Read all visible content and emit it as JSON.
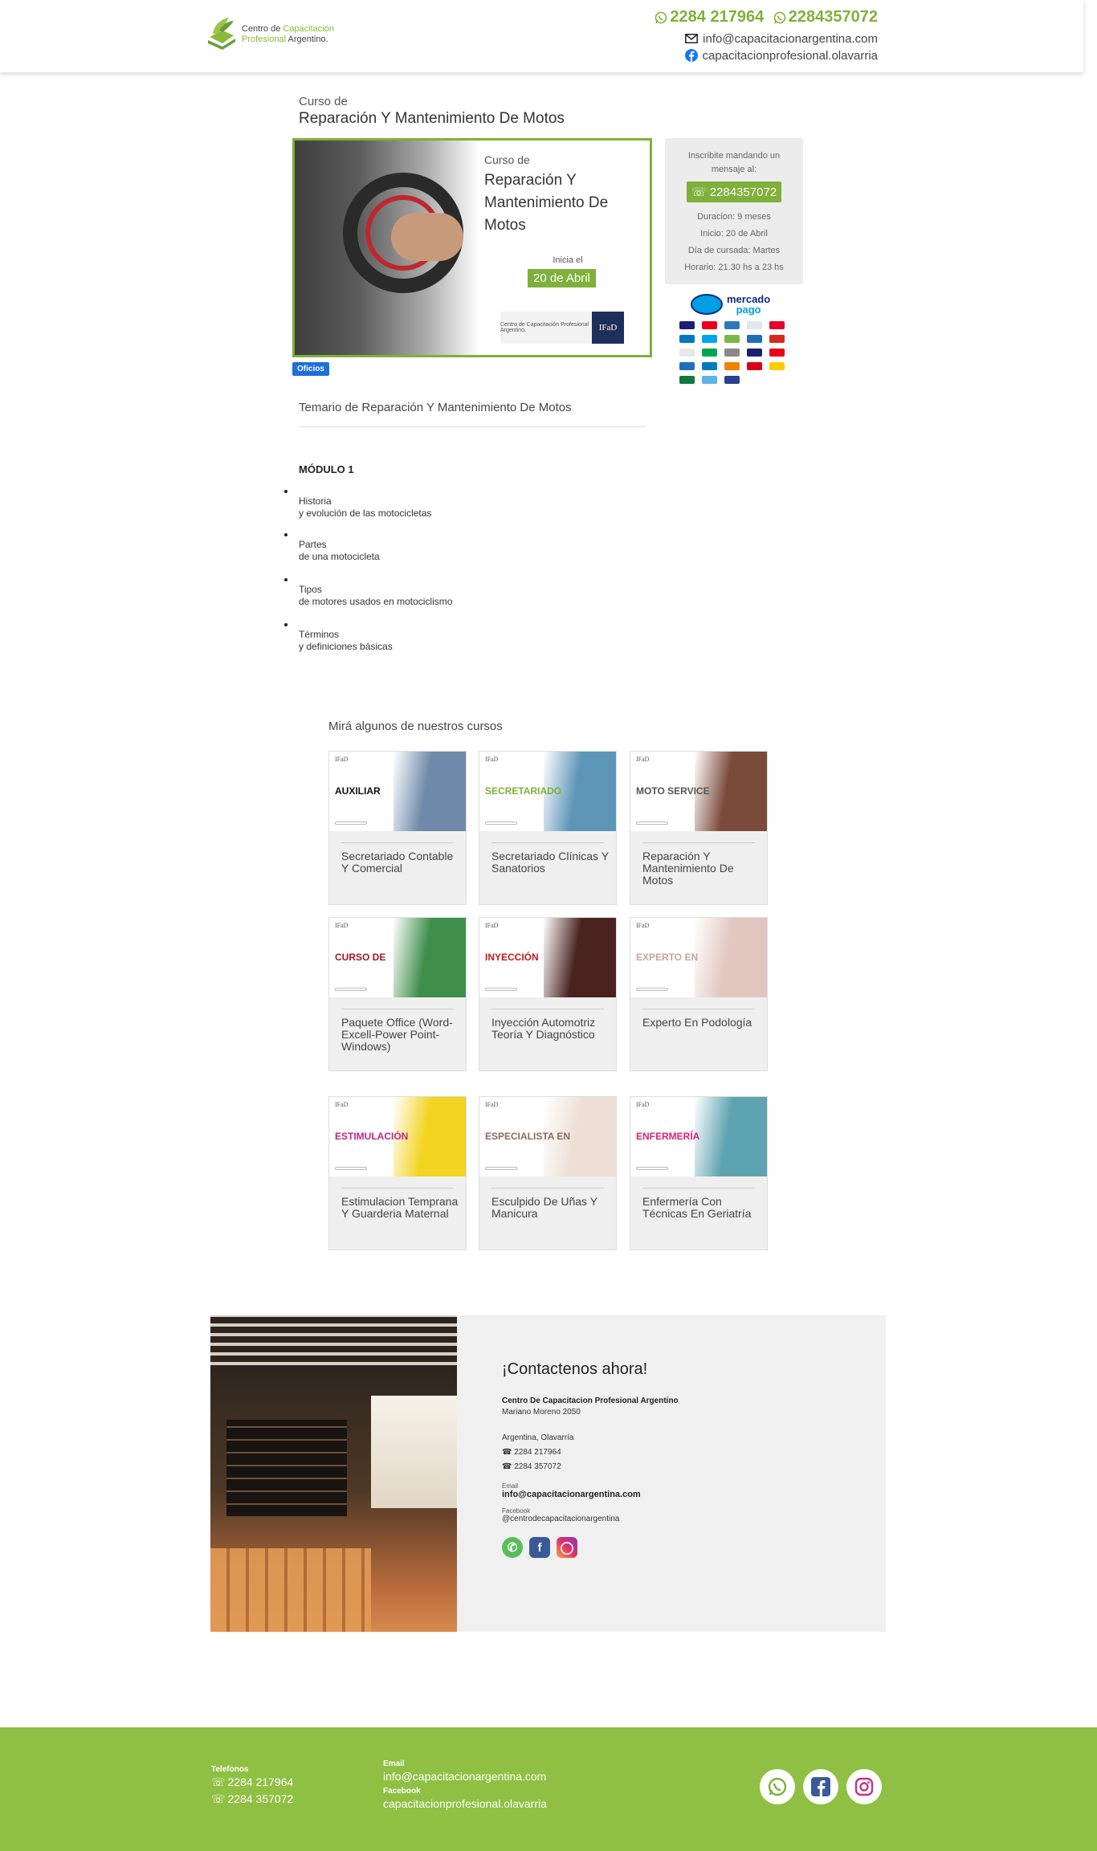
{
  "header": {
    "logo_line1": "Centro de",
    "logo_line1_green": "Capacitación",
    "logo_line2_green": "Profesional",
    "logo_line2": "Argentino.",
    "phone1": "2284 217964",
    "phone2": "2284357072",
    "email": "info@capacitacionargentina.com",
    "facebook": "capacitacionprofesional.olavarria"
  },
  "course": {
    "kicker": "Curso de",
    "title": "Reparación Y Mantenimiento De Motos",
    "banner_kicker": "Curso de",
    "banner_title": "Reparación Y Mantenimiento De Motos",
    "start_label": "Inicia el",
    "start_date": "20 de Abril",
    "banner_logo_text": "Centro de Capacitación Profesional Argentino.",
    "banner_ifad": "IFaD",
    "tag": "Oficios"
  },
  "sidebar": {
    "intro": "Inscribite mandando un mensaje al:",
    "whatsapp_button": "2284357072",
    "duration": "Duracion: 9 meses",
    "start": "Inicio: 20 de Abril",
    "day": "Día de cursada: Martes",
    "schedule": "Horario: 21.30 hs a 23 hs"
  },
  "payment": {
    "brand_line1": "mercado",
    "brand_line2": "pago",
    "card_colors": [
      "#1a1f71",
      "#eb001b",
      "#2e77bc",
      "#dfe7ef",
      "#e4002b",
      "#0079be",
      "#00a6e8",
      "#7ab648",
      "#1f6fb8",
      "#d52b1e",
      "#e8e8e8",
      "#00a651",
      "#8a8a8a",
      "#1a1f71",
      "#eb001b",
      "#1f6fb8",
      "#0079be",
      "#f08200",
      "#d6001c",
      "#ffcc00",
      "#0f7a3f",
      "#5bb4e5",
      "#2a3f8f"
    ]
  },
  "temario": {
    "title": "Temario de Reparación Y Mantenimiento De Motos",
    "module": "MÓDULO 1",
    "topics": [
      {
        "line1": "Historia",
        "line2": "y evolución de las motocicletas"
      },
      {
        "line1": "Partes",
        "line2": "de una motocicleta"
      },
      {
        "line1": "Tipos",
        "line2": "de motores usados en motociclismo"
      },
      {
        "line1": "Términos",
        "line2": "y definiciones básicas"
      }
    ]
  },
  "courses": {
    "heading": "Mirá algunos de nuestros cursos",
    "items": [
      {
        "thumb_label": "AUXILIAR",
        "title": "Secretariado Contable Y Comercial",
        "color": "#111111",
        "img": "#6f8aa8"
      },
      {
        "thumb_label": "SECRETARIADO",
        "title": "Secretariado Clínicas Y Sanatorios",
        "color": "#7fb03a",
        "img": "#5e96b8"
      },
      {
        "thumb_label": "MOTO SERVICE",
        "title": "Reparación Y Mantenimiento De Motos",
        "color": "#555555",
        "img": "#7a4a3a"
      },
      {
        "thumb_label": "CURSO DE",
        "title": "Paquete Office (Word-Excell-Power Point-Windows)",
        "color": "#a0182a",
        "img": "#3e8e4b"
      },
      {
        "thumb_label": "INYECCIÓN",
        "title": "Inyección Automotriz Teoría Y Diagnóstico",
        "color": "#c2181f",
        "img": "#4a2320"
      },
      {
        "thumb_label": "EXPERTO EN",
        "title": "Experto En Podología",
        "color": "#c9a39c",
        "img": "#e2c7c0"
      },
      {
        "thumb_label": "ESTIMULACIÓN",
        "title": "Estimulacion Temprana Y Guarderia Maternal",
        "color": "#c1248b",
        "img": "#f2d31f"
      },
      {
        "thumb_label": "ESPECIALISTA EN",
        "title": "Esculpido De Uñas Y Manicura",
        "color": "#8c6b5a",
        "img": "#eedfd6"
      },
      {
        "thumb_label": "ENFERMERÍA",
        "title": "Enfermería Con Técnicas En Geriatría",
        "color": "#d4237a",
        "img": "#5ea3b1"
      }
    ],
    "ifad": "IFaD"
  },
  "contact": {
    "heading": "¡Contactenos ahora!",
    "org": "Centro De Capacitacion Profesional Argentino",
    "address": "Mariano Moreno 2050",
    "city": "Argentina, Olavarría",
    "phone1": "2284 217964",
    "phone2": "2284 357072",
    "email_label": "Email",
    "email": "info@capacitacionargentina.com",
    "facebook_label": "Facebook",
    "facebook": "@centrodecapacitacionargentina"
  },
  "footer": {
    "phones_label": "Telefonos",
    "phone1": "2284 217964",
    "phone2": "2284 357072",
    "email_label": "Email",
    "email": "info@capacitacionargentina.com",
    "facebook_label": "Facebook",
    "facebook": "capacitacionprofesional.olavarria"
  },
  "colors": {
    "brand_green": "#7fb03a",
    "footer_green": "#8fc043",
    "tag_blue": "#1e6fd9"
  }
}
